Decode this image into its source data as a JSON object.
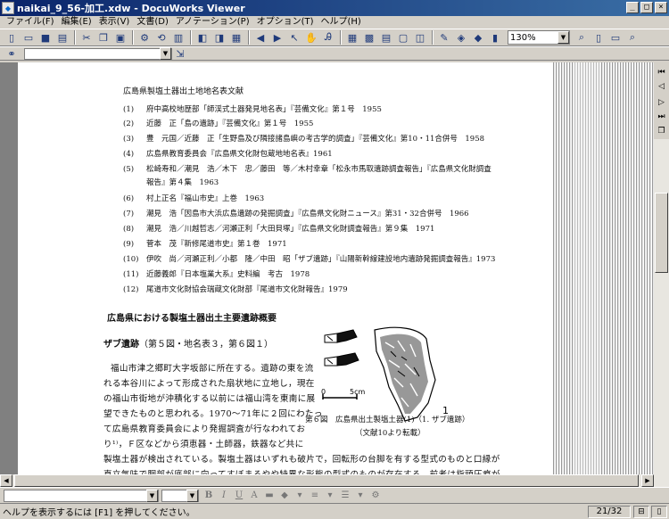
{
  "window": {
    "title": "naikai_9_56-加工.xdw - DocuWorks Viewer",
    "minimize_glyph": "_",
    "maximize_glyph": "□",
    "close_glyph": "×"
  },
  "menu": [
    "ファイル(F)",
    "編集(E)",
    "表示(V)",
    "文書(D)",
    "アノテーション(P)",
    "オプション(T)",
    "ヘルプ(H)"
  ],
  "toolbar": {
    "zoom": "130%"
  },
  "page": {
    "list_title": "広島県製塩土器出土地地名表文献",
    "refs": [
      {
        "n": "(1)",
        "t": "府中高校地歴部「師渓式土器発見地名表」『芸備文化』第１号　1955"
      },
      {
        "n": "(2)",
        "t": "近藤　正「島の遺跡」『芸備文化』第１号　1955"
      },
      {
        "n": "(3)",
        "t": "豊　元国／近藤　正「生野島及び隣接諸島嶼の考古学的調査」『芸備文化』第10・11合併号　1958"
      },
      {
        "n": "(4)",
        "t": "広島県教育委員会『広島県文化財包蔵地地名表』1961"
      },
      {
        "n": "(5)",
        "t": "松崎寿和／潮見　浩／木下　忠／藤田　等／木村幸章「松永市馬取遺跡調査報告」『広島県文化財調査",
        "cont": "報告』第４集　1963"
      },
      {
        "n": "(6)",
        "t": "村上正名『福山市史』上巻　1963"
      },
      {
        "n": "(7)",
        "t": "潮見　浩「因島市大浜広島遺跡の発掘調査」『広島県文化財ニュース』第31・32合併号　1966"
      },
      {
        "n": "(8)",
        "t": "潮見　浩／川越哲志／河瀬正利「大田貝塚」『広島県文化財調査報告』第９集　1971"
      },
      {
        "n": "(9)",
        "t": "菅本　茂『新修尾道市史』第１巻　1971"
      },
      {
        "n": "(10)",
        "t": "伊吹　尚／河瀬正利／小都　隆／中田　昭「ザブ遺跡」『山陽新幹線建設地内遺跡発掘調査報告』1973"
      },
      {
        "n": "(11)",
        "t": "近藤義郎『日本塩業大系』史料編　考古　1978"
      },
      {
        "n": "(12)",
        "t": "尾道市文化財協会瑞蔵文化財部『尾道市文化財報告』1979"
      }
    ],
    "section_title": "広島県における製塩土器出土主要遺跡概要",
    "site_name": "ザブ遺跡",
    "site_ref": "（第５図・地名表３，第６図１）",
    "body": [
      "福山市津之郷町大字坂部に所在する。遺跡の東を流",
      "れる本谷川によって形成された扇状地に立地し，現在",
      "の福山市街地が沖積化する以前には福山湾を東南に展",
      "望できたものと思われる。1970〜71年に２回にわたっ",
      "て広島県教育委員会により発掘調査が行なわれてお",
      "り¹⁾，Ｆ区などから須恵器・土師器，鉄器など共に",
      "製塩土器が検出されている。製塩土器はいずれも破片で，回転形の台脚を有する型式のものと口縁が",
      "直立気味で胴部が底部に向ってすぼまるやや特異な形態の型式のものが存在する。前者は指頭圧痕が"
    ],
    "figure": {
      "scale_zero": "0",
      "scale_label": "5cm",
      "number": "1",
      "caption": "第６図　広島県出土製塩土器(1)（1. ザブ遺跡）",
      "source": "（文献10より転載）"
    }
  },
  "format": {
    "bold": "B",
    "italic": "I",
    "underline": "U"
  },
  "status": {
    "message": "ヘルプを表示するには [F1] を押してください。",
    "page": "21/32"
  }
}
